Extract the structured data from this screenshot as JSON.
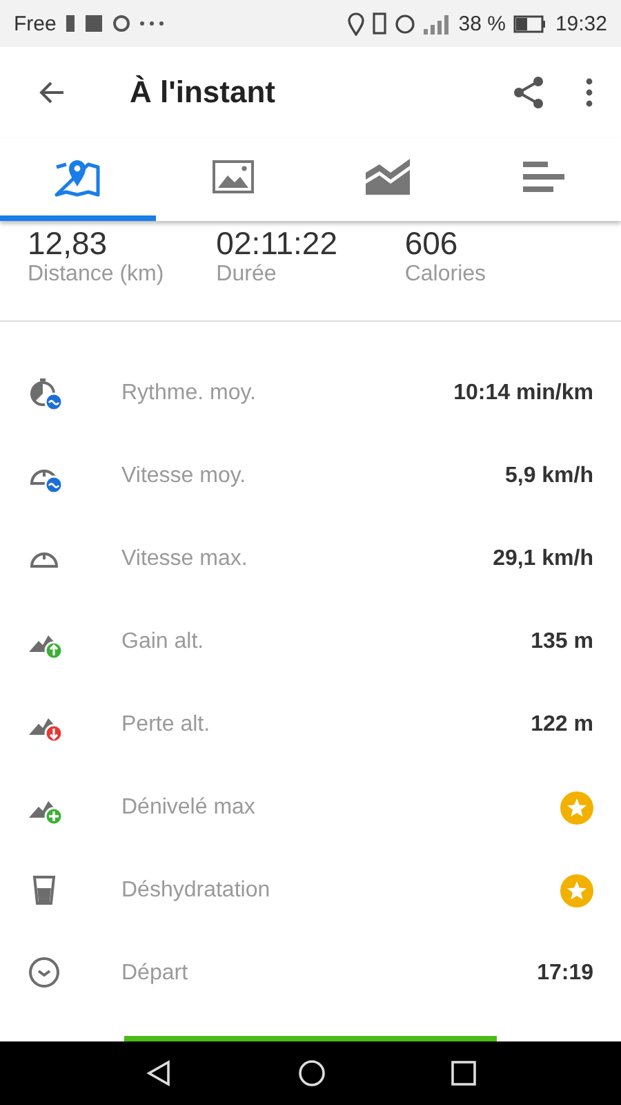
{
  "status_bar": {
    "carrier": "Free",
    "battery": "38 %",
    "time": "19:32"
  },
  "app_bar": {
    "title": "À l'instant"
  },
  "tabs": [
    {
      "selected": true
    },
    {
      "selected": false
    },
    {
      "selected": false
    },
    {
      "selected": false
    }
  ],
  "summary": [
    {
      "value": "12,83",
      "label": "Distance (km)"
    },
    {
      "value": "02:11:22",
      "label": "Durée"
    },
    {
      "value": "606",
      "label": "Calories"
    }
  ],
  "metrics": [
    {
      "label": "Rythme. moy.",
      "kind": "value",
      "value": "10:14 min/km"
    },
    {
      "label": "Vitesse moy.",
      "kind": "value",
      "value": "5,9 km/h"
    },
    {
      "label": "Vitesse max.",
      "kind": "value",
      "value": "29,1 km/h"
    },
    {
      "label": "Gain alt.",
      "kind": "value",
      "value": "135 m"
    },
    {
      "label": "Perte alt.",
      "kind": "value",
      "value": "122 m"
    },
    {
      "label": "Dénivelé max",
      "kind": "premium"
    },
    {
      "label": "Déshydratation",
      "kind": "premium"
    },
    {
      "label": "Départ",
      "kind": "value",
      "value": "17:19"
    }
  ]
}
